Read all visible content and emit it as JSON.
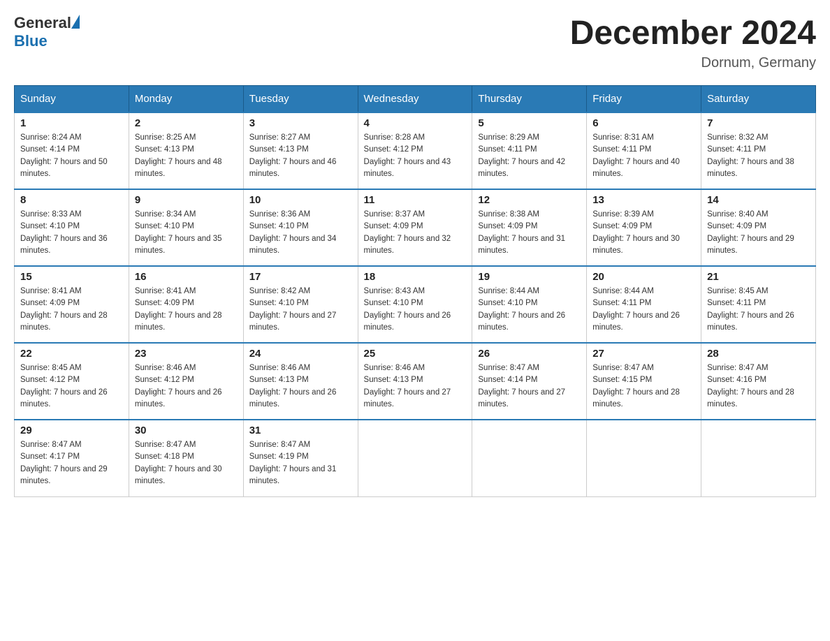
{
  "header": {
    "logo_general": "General",
    "logo_blue": "Blue",
    "month_title": "December 2024",
    "location": "Dornum, Germany"
  },
  "weekdays": [
    "Sunday",
    "Monday",
    "Tuesday",
    "Wednesday",
    "Thursday",
    "Friday",
    "Saturday"
  ],
  "weeks": [
    [
      {
        "day": "1",
        "sunrise": "8:24 AM",
        "sunset": "4:14 PM",
        "daylight": "7 hours and 50 minutes."
      },
      {
        "day": "2",
        "sunrise": "8:25 AM",
        "sunset": "4:13 PM",
        "daylight": "7 hours and 48 minutes."
      },
      {
        "day": "3",
        "sunrise": "8:27 AM",
        "sunset": "4:13 PM",
        "daylight": "7 hours and 46 minutes."
      },
      {
        "day": "4",
        "sunrise": "8:28 AM",
        "sunset": "4:12 PM",
        "daylight": "7 hours and 43 minutes."
      },
      {
        "day": "5",
        "sunrise": "8:29 AM",
        "sunset": "4:11 PM",
        "daylight": "7 hours and 42 minutes."
      },
      {
        "day": "6",
        "sunrise": "8:31 AM",
        "sunset": "4:11 PM",
        "daylight": "7 hours and 40 minutes."
      },
      {
        "day": "7",
        "sunrise": "8:32 AM",
        "sunset": "4:11 PM",
        "daylight": "7 hours and 38 minutes."
      }
    ],
    [
      {
        "day": "8",
        "sunrise": "8:33 AM",
        "sunset": "4:10 PM",
        "daylight": "7 hours and 36 minutes."
      },
      {
        "day": "9",
        "sunrise": "8:34 AM",
        "sunset": "4:10 PM",
        "daylight": "7 hours and 35 minutes."
      },
      {
        "day": "10",
        "sunrise": "8:36 AM",
        "sunset": "4:10 PM",
        "daylight": "7 hours and 34 minutes."
      },
      {
        "day": "11",
        "sunrise": "8:37 AM",
        "sunset": "4:09 PM",
        "daylight": "7 hours and 32 minutes."
      },
      {
        "day": "12",
        "sunrise": "8:38 AM",
        "sunset": "4:09 PM",
        "daylight": "7 hours and 31 minutes."
      },
      {
        "day": "13",
        "sunrise": "8:39 AM",
        "sunset": "4:09 PM",
        "daylight": "7 hours and 30 minutes."
      },
      {
        "day": "14",
        "sunrise": "8:40 AM",
        "sunset": "4:09 PM",
        "daylight": "7 hours and 29 minutes."
      }
    ],
    [
      {
        "day": "15",
        "sunrise": "8:41 AM",
        "sunset": "4:09 PM",
        "daylight": "7 hours and 28 minutes."
      },
      {
        "day": "16",
        "sunrise": "8:41 AM",
        "sunset": "4:09 PM",
        "daylight": "7 hours and 28 minutes."
      },
      {
        "day": "17",
        "sunrise": "8:42 AM",
        "sunset": "4:10 PM",
        "daylight": "7 hours and 27 minutes."
      },
      {
        "day": "18",
        "sunrise": "8:43 AM",
        "sunset": "4:10 PM",
        "daylight": "7 hours and 26 minutes."
      },
      {
        "day": "19",
        "sunrise": "8:44 AM",
        "sunset": "4:10 PM",
        "daylight": "7 hours and 26 minutes."
      },
      {
        "day": "20",
        "sunrise": "8:44 AM",
        "sunset": "4:11 PM",
        "daylight": "7 hours and 26 minutes."
      },
      {
        "day": "21",
        "sunrise": "8:45 AM",
        "sunset": "4:11 PM",
        "daylight": "7 hours and 26 minutes."
      }
    ],
    [
      {
        "day": "22",
        "sunrise": "8:45 AM",
        "sunset": "4:12 PM",
        "daylight": "7 hours and 26 minutes."
      },
      {
        "day": "23",
        "sunrise": "8:46 AM",
        "sunset": "4:12 PM",
        "daylight": "7 hours and 26 minutes."
      },
      {
        "day": "24",
        "sunrise": "8:46 AM",
        "sunset": "4:13 PM",
        "daylight": "7 hours and 26 minutes."
      },
      {
        "day": "25",
        "sunrise": "8:46 AM",
        "sunset": "4:13 PM",
        "daylight": "7 hours and 27 minutes."
      },
      {
        "day": "26",
        "sunrise": "8:47 AM",
        "sunset": "4:14 PM",
        "daylight": "7 hours and 27 minutes."
      },
      {
        "day": "27",
        "sunrise": "8:47 AM",
        "sunset": "4:15 PM",
        "daylight": "7 hours and 28 minutes."
      },
      {
        "day": "28",
        "sunrise": "8:47 AM",
        "sunset": "4:16 PM",
        "daylight": "7 hours and 28 minutes."
      }
    ],
    [
      {
        "day": "29",
        "sunrise": "8:47 AM",
        "sunset": "4:17 PM",
        "daylight": "7 hours and 29 minutes."
      },
      {
        "day": "30",
        "sunrise": "8:47 AM",
        "sunset": "4:18 PM",
        "daylight": "7 hours and 30 minutes."
      },
      {
        "day": "31",
        "sunrise": "8:47 AM",
        "sunset": "4:19 PM",
        "daylight": "7 hours and 31 minutes."
      },
      null,
      null,
      null,
      null
    ]
  ]
}
